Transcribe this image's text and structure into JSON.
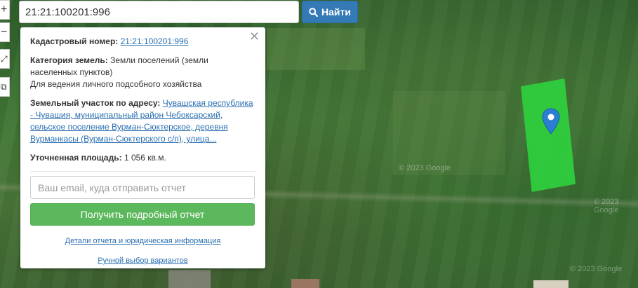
{
  "search": {
    "value": "21:21:100201:996",
    "button_label": "Найти"
  },
  "controls": {
    "zoom_in": "+",
    "zoom_out": "−",
    "fullscreen": "⤢",
    "layers": "⧉"
  },
  "popup": {
    "cadastral_label": "Кадастровый номер:",
    "cadastral_value": "21:21:100201:996",
    "category_label": "Категория земель:",
    "category_value": "Земли поселений (земли населенных пунктов)",
    "usage": "Для ведения личного подсобного хозяйства",
    "address_label": "Земельный участок по адресу:",
    "address_value": "Чувашская республика - Чувашия, муниципальный район Чебоксарский, сельское поселение Вурман-Сюктерское, деревня Вурманкасы (Вурман-Сюктерского с/п), улица...",
    "area_label": "Уточненная площадь:",
    "area_value": "1 056 кв.м.",
    "email_placeholder": "Ваш email, куда отправить отчет",
    "report_button": "Получить подробный отчет",
    "link_details": "Детали отчета и юридическая информация",
    "link_manual": "Ручной выбор вариантов"
  },
  "map": {
    "copyright_1": "© 2023 Google",
    "copyright_2": "© 2023 Google",
    "copyright_3": "© 2023 Google"
  },
  "colors": {
    "parcel": "#2fcf3d",
    "search_button": "#337ab7",
    "report_button": "#5cb85c",
    "link": "#2a6fb0"
  }
}
